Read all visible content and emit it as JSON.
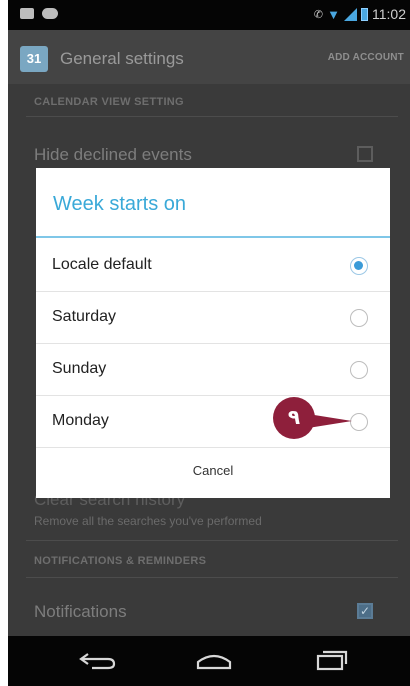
{
  "status_bar": {
    "time": "11:02",
    "icons": [
      "mail-icon",
      "voicemail-icon",
      "vibrate-icon",
      "wifi-icon",
      "signal-icon",
      "battery-icon"
    ]
  },
  "action_bar": {
    "app_icon_text": "31",
    "title": "General settings",
    "add_account_label": "ADD ACCOUNT"
  },
  "background": {
    "section_calendar_view": "CALENDAR VIEW SETTING",
    "hide_declined_label": "Hide declined events",
    "clear_search_label": "Clear search history",
    "clear_search_sub": "Remove all the searches you've performed",
    "section_notifications": "NOTIFICATIONS & REMINDERS",
    "notifications_label": "Notifications",
    "notifications_checked": true
  },
  "dialog": {
    "title": "Week starts on",
    "options": [
      {
        "label": "Locale default",
        "selected": true
      },
      {
        "label": "Saturday",
        "selected": false
      },
      {
        "label": "Sunday",
        "selected": false
      },
      {
        "label": "Monday",
        "selected": false
      }
    ],
    "cancel_label": "Cancel"
  },
  "annotation": {
    "step_number": "٩"
  },
  "colors": {
    "accent": "#3aa9d8",
    "marker": "#8e1f3b",
    "radio_selected": "#3b9bd8"
  }
}
